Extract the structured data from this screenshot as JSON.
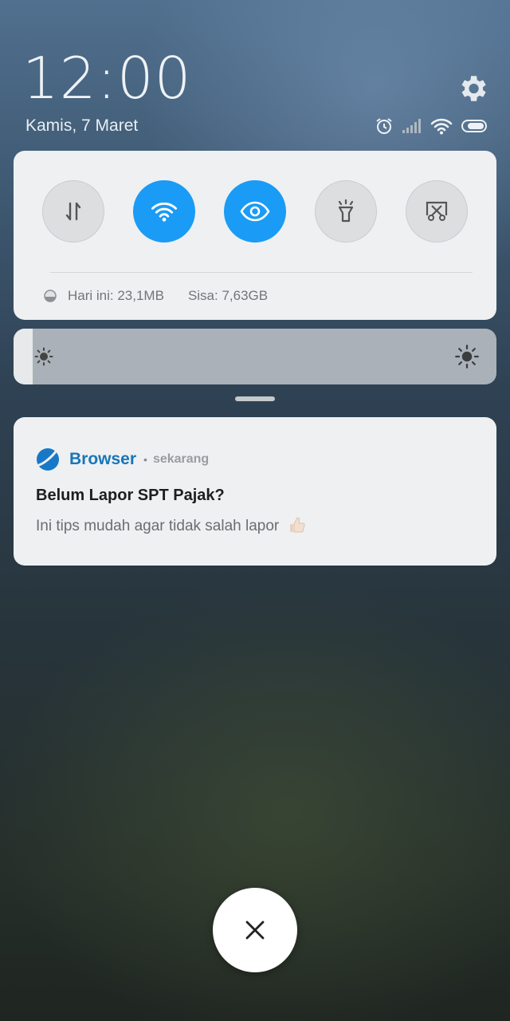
{
  "header": {
    "time": "12:00",
    "date": "Kamis, 7 Maret"
  },
  "status_icons": [
    "alarm-icon",
    "signal-icon",
    "wifi-icon",
    "battery-icon"
  ],
  "quick_settings": {
    "toggles": [
      {
        "name": "mobile-data",
        "icon": "data-arrows-icon",
        "on": false
      },
      {
        "name": "wifi",
        "icon": "wifi-icon",
        "on": true
      },
      {
        "name": "reading-mode",
        "icon": "eye-icon",
        "on": true
      },
      {
        "name": "flashlight",
        "icon": "flashlight-icon",
        "on": false
      },
      {
        "name": "screenshot",
        "icon": "screenshot-icon",
        "on": false
      }
    ],
    "data_today": "Hari ini: 23,1MB",
    "data_remaining": "Sisa: 7,63GB"
  },
  "brightness": {
    "level": 0.04
  },
  "notification": {
    "app_name": "Browser",
    "separator": "•",
    "time": "sekarang",
    "title": "Belum Lapor SPT Pajak?",
    "body": "Ini tips mudah agar tidak salah lapor"
  },
  "colors": {
    "accent": "#1a9bf5",
    "app_name": "#1876b8",
    "card": "#eef0f2"
  }
}
